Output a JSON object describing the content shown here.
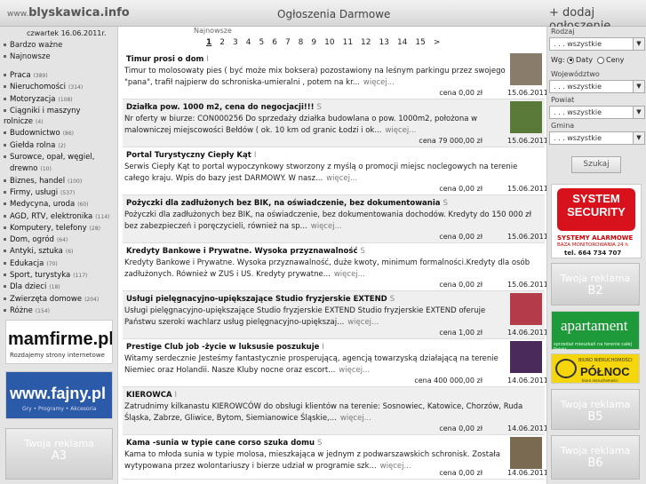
{
  "header": {
    "logo_prefix": "www.",
    "logo_main": "blyskawica.info",
    "site_title": "Ogłoszenia Darmowe",
    "add_ad": "+ dodaj ogłoszenie"
  },
  "sidebar": {
    "date": "czwartek 16.06.2011r.",
    "links": [
      "Bardzo ważne",
      "Najnowsze"
    ],
    "categories": [
      {
        "label": "Praca",
        "count": "(389)"
      },
      {
        "label": "Nieruchomości",
        "count": "(314)"
      },
      {
        "label": "Motoryzacja",
        "count": "(108)"
      },
      {
        "label": "Ciągniki i maszyny rolnicze",
        "count": "(4)"
      },
      {
        "label": "Budownictwo",
        "count": "(86)"
      },
      {
        "label": "Giełda rolna",
        "count": "(2)"
      },
      {
        "label": "Surowce, opał, węgiel,",
        "count": ""
      },
      {
        "label": "drewno",
        "count": "(10)"
      },
      {
        "label": "Biznes, handel",
        "count": "(100)"
      },
      {
        "label": "Firmy, usługi",
        "count": "(537)"
      },
      {
        "label": "Medycyna, uroda",
        "count": "(60)"
      },
      {
        "label": "AGD, RTV, elektronika",
        "count": "(114)"
      },
      {
        "label": "Komputery, telefony",
        "count": "(28)"
      },
      {
        "label": "Dom, ogród",
        "count": "(64)"
      },
      {
        "label": "Antyki, sztuka",
        "count": "(6)"
      },
      {
        "label": "Edukacja",
        "count": "(70)"
      },
      {
        "label": "Sport, turystyka",
        "count": "(117)"
      },
      {
        "label": "Dla dzieci",
        "count": "(18)"
      },
      {
        "label": "Zwierzęta domowe",
        "count": "(204)"
      },
      {
        "label": "Różne",
        "count": "(154)"
      }
    ],
    "banner_mam_title": "mamfirme.pl",
    "banner_mam_sub": "Rozdajemy strony internetowe",
    "banner_faj_title": "www.fajny.pl",
    "banner_faj_sub": "Gry • Programy • Akcesoria",
    "ad_slot_label": "Twoja reklama",
    "ad_slot_code": "A3"
  },
  "pagination": {
    "label": "Najnowsze",
    "pages": [
      "1",
      "2",
      "3",
      "4",
      "5",
      "6",
      "7",
      "8",
      "9",
      "10",
      "11",
      "12",
      "13",
      "14",
      "15",
      ">"
    ]
  },
  "listings": [
    {
      "title": "Timur prosi o dom",
      "tag": "I",
      "desc": "Timur to molosowaty pies ( być może mix boksera) pozostawiony na leśnym parkingu przez swojego \"pana\", trafił najpierw do schroniska-umieralni , potem na kr...",
      "more": "więcej...",
      "price": "cena 0,00 zł",
      "date": "15.06.2011",
      "thumb": "dog"
    },
    {
      "title": "Działka pow. 1000 m2, cena do negocjacji!!!",
      "tag": "S",
      "desc": "Nr oferty w biurze: CON000256 Do sprzedaży działka budowlana o pow. 1000m2, położona w malowniczej miejscowości Bełdów ( ok. 10 km od granic Łodzi i ok...",
      "more": "więcej...",
      "price": "cena 79 000,00 zł",
      "date": "15.06.2011",
      "thumb": "field"
    },
    {
      "title": "Portal Turystyczny Ciepły Kąt",
      "tag": "I",
      "desc": "Serwis Ciepły Kąt to portal wypoczynkowy stworzony z myślą o promocji miejsc noclegowych na terenie całego kraju. Wpis do bazy jest DARMOWY. W nasz...",
      "more": "więcej...",
      "price": "cena 0,00 zł",
      "date": "15.06.2011",
      "thumb": ""
    },
    {
      "title": "Pożyczki dla zadłużonych bez BIK, na oświadczenie, bez dokumentowania",
      "tag": "S",
      "desc": "Pożyczki dla zadłużonych bez BIK, na oświadczenie, bez dokumentowania dochodów. Kredyty do 150 000 zł bez zabezpieczeń i poręczycieli, również na sp...",
      "more": "więcej...",
      "price": "cena 0,00 zł",
      "date": "15.06.2011",
      "thumb": ""
    },
    {
      "title": "Kredyty Bankowe i Prywatne. Wysoka przyznawalność",
      "tag": "S",
      "desc": "Kredyty Bankowe i Prywatne. Wysoka przyznawalność, duże kwoty, minimum formalności.Kredyty dla osób zadłużonych. Również w ZUS i US. Kredyty prywatne...",
      "more": "więcej...",
      "price": "cena 0,00 zł",
      "date": "15.06.2011",
      "thumb": ""
    },
    {
      "title": "Usługi pielęgnacyjno-upiększające Studio fryzjerskie EXTEND",
      "tag": "S",
      "desc": "Usługi pielęgnacyjno-upiększające Studio fryzjerskie EXTEND Studio fryzjerskie EXTEND oferuje Państwu szeroki wachlarz usług pielęgnacyjno-upiększaj...",
      "more": "więcej...",
      "price": "cena 1,00 zł",
      "date": "14.06.2011",
      "thumb": "salon"
    },
    {
      "title": "Prestige Club job -życie w luksusie poszukuje",
      "tag": "I",
      "desc": "Witamy serdecznie Jesteśmy fantastycznie prosperującą, agencją towarzyską działającą na terenie Niemiec oraz Holandii. Nasze Kluby nocne oraz escort...",
      "more": "więcej...",
      "price": "cena 400 000,00 zł",
      "date": "14.06.2011",
      "thumb": "club"
    },
    {
      "title": "KIEROWCA",
      "tag": "I",
      "desc": "Zatrudnimy kilkanastu KIEROWCÓW do obsługi klientów na terenie: Sosnowiec, Katowice, Chorzów, Ruda Śląska, Zabrze, Gliwice, Bytom, Siemianowice Śląskie,...",
      "more": "więcej...",
      "price": "cena 0,00 zł",
      "date": "14.06.2011",
      "thumb": ""
    },
    {
      "title": "Kama -sunia w typie cane corso szuka domu",
      "tag": "S",
      "desc": "Kama to młoda sunia w typie molosa, mieszkająca w jednym z podwarszawskich schronisk. Została wytypowana przez wolontariuszy i bierze udział w programie szk...",
      "more": "więcej...",
      "price": "cena 0,00 zł",
      "date": "14.06.2011",
      "thumb": "dog2"
    }
  ],
  "filters": {
    "rodzaj_label": "Rodzaj",
    "all_option": ". . . wszystkie",
    "sort_label": "Wg:",
    "sort_date": "Daty",
    "sort_price": "Ceny",
    "woj_label": "Województwo",
    "powiat_label": "Powiat",
    "gmina_label": "Gmina",
    "search_button": "Szukaj"
  },
  "right_banners": {
    "sys_l1": "SYSTEM",
    "sys_l2": "SECURITY",
    "sys_l3": "SYSTEMY ALARMOWE",
    "sys_l4": "BAZA MONITOROWANIA 24 h",
    "sys_l5": "tel. 664 734 707",
    "ad_label": "Twoja reklama",
    "b2": "B2",
    "apt_title": "apartament",
    "apt_sub": "sprzedaż mieszkań na terenie całej Polski",
    "pol_top": "BIURO NIERUCHOMOŚCI",
    "pol_title": "PÓŁNOC",
    "pol_bottom": "biuro nieruchomości",
    "b5": "B5",
    "b6": "B6"
  }
}
